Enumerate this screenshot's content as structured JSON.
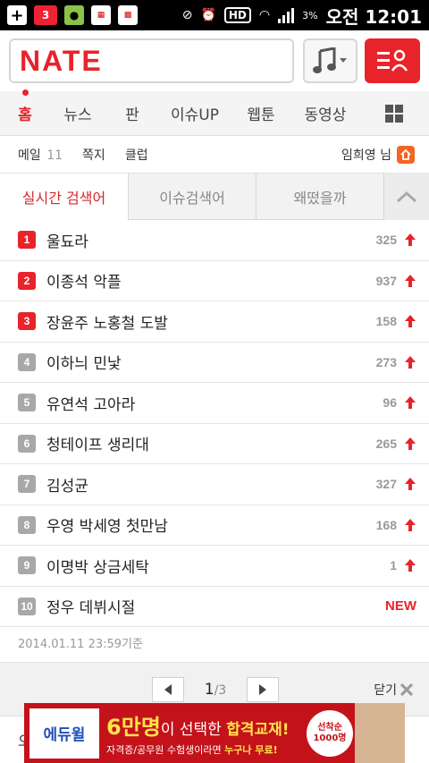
{
  "status_bar": {
    "battery_badge": "3",
    "battery_percent": "3%",
    "hd_label": "HD",
    "time": "오전 12:01"
  },
  "header": {
    "logo": "NATE"
  },
  "nav": {
    "items": [
      "홈",
      "뉴스",
      "판",
      "이슈UP",
      "웹툰",
      "동영상"
    ]
  },
  "user_bar": {
    "mail_label": "메일",
    "mail_count": "11",
    "memo_label": "쪽지",
    "club_label": "클럽",
    "user_name": "임희영 님"
  },
  "tabs": [
    "실시간 검색어",
    "이슈검색어",
    "왜떴을까"
  ],
  "ranking": [
    {
      "rank": "1",
      "keyword": "울됴라",
      "change": "325"
    },
    {
      "rank": "2",
      "keyword": "이종석 악플",
      "change": "937"
    },
    {
      "rank": "3",
      "keyword": "장윤주 노홍철 도발",
      "change": "158"
    },
    {
      "rank": "4",
      "keyword": "이하늬 민낯",
      "change": "273"
    },
    {
      "rank": "5",
      "keyword": "유연석 고아라",
      "change": "96"
    },
    {
      "rank": "6",
      "keyword": "청테이프 생리대",
      "change": "265"
    },
    {
      "rank": "7",
      "keyword": "김성균",
      "change": "327"
    },
    {
      "rank": "8",
      "keyword": "우영 박세영 첫만남",
      "change": "168"
    },
    {
      "rank": "9",
      "keyword": "이명박 상금세탁",
      "change": "1"
    },
    {
      "rank": "10",
      "keyword": "정우 데뷔시절",
      "change": "NEW"
    }
  ],
  "timestamp": "2014.01.11 23:59기준",
  "pager": {
    "current": "1",
    "total": "/3",
    "close_label": "닫기"
  },
  "bottom_partial_text": "오",
  "ad": {
    "logo": "에듀윌",
    "line1_big": "6만명",
    "line1_mid": "이 선택한 ",
    "line1_highlight": "합격교재!",
    "line2_a": "자격증/공무원 수험생이라면 ",
    "line2_highlight": "누구나 무료!",
    "badge_line1": "선착순",
    "badge_line2": "1000명"
  },
  "colors": {
    "brand_red": "#e8232a",
    "active_tab_text": "#d6262c",
    "rank_gray": "#a8a8a8",
    "ad_red": "#c4121a"
  }
}
